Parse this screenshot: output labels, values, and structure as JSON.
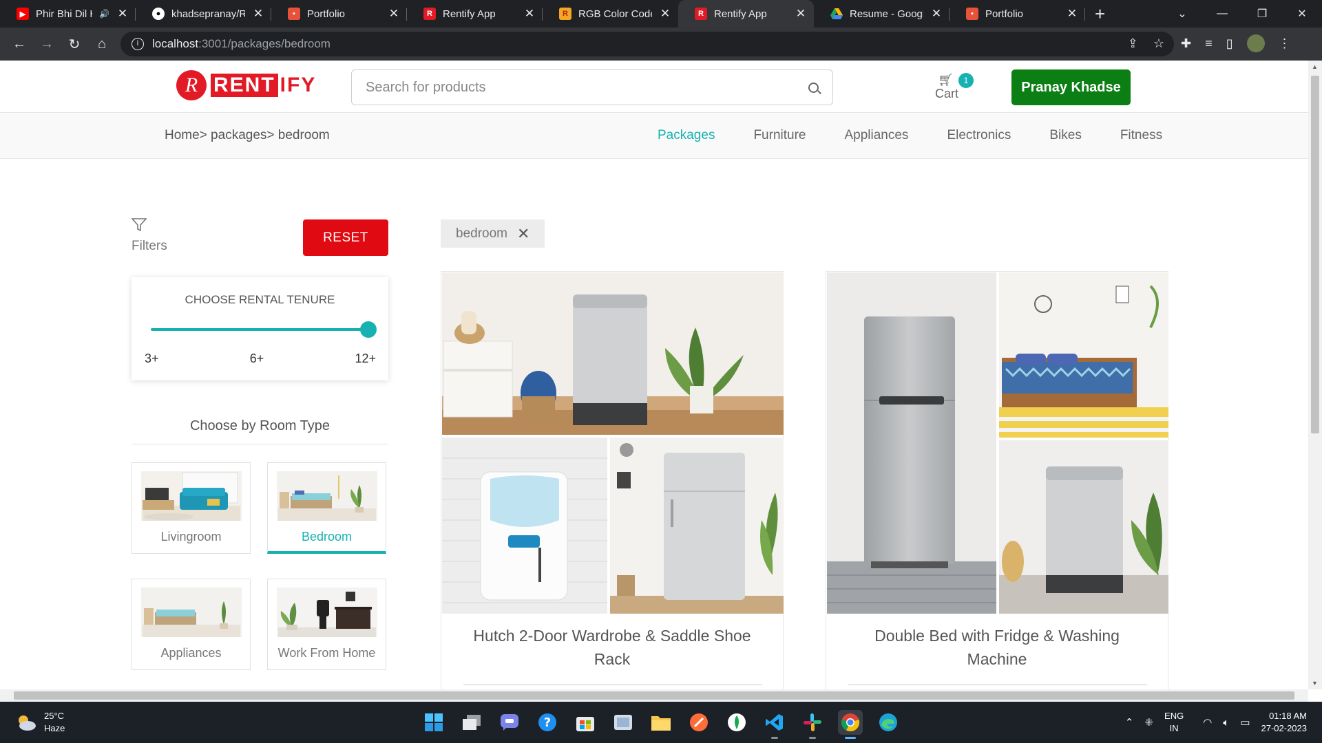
{
  "browser": {
    "tabs": [
      {
        "title": "Phir Bhi Dil Ha",
        "favicon": "youtube-icon",
        "color": "#ff0000",
        "audio": true,
        "active": false
      },
      {
        "title": "khadsepranay/Re",
        "favicon": "github-icon",
        "color": "#ffffff",
        "active": false
      },
      {
        "title": "Portfolio",
        "favicon": "portfolio-icon",
        "color": "#e8523a",
        "active": false
      },
      {
        "title": "Rentify App",
        "favicon": "rentify-icon",
        "color": "#e11a26",
        "active": false
      },
      {
        "title": "RGB Color Codes",
        "favicon": "rgb-icon",
        "color": "#f5a623",
        "active": false
      },
      {
        "title": "Rentify App",
        "favicon": "rentify-icon",
        "color": "#e11a26",
        "active": true
      },
      {
        "title": "Resume - Google",
        "favicon": "google-drive-icon",
        "color": "#1fa463",
        "active": false
      },
      {
        "title": "Portfolio",
        "favicon": "portfolio-icon",
        "color": "#e8523a",
        "active": false
      }
    ],
    "url_host": "localhost",
    "url_path": ":3001/packages/bedroom"
  },
  "header": {
    "logo_letter": "R",
    "logo_rent": "RENT",
    "logo_ify": "IFY",
    "search_placeholder": "Search for products",
    "cart_label": "Cart",
    "cart_count": "1",
    "user_name": "Pranay Khadse"
  },
  "subnav": {
    "breadcrumb": "Home> packages> bedroom",
    "categories": [
      "Packages",
      "Furniture",
      "Appliances",
      "Electronics",
      "Bikes",
      "Fitness"
    ],
    "active_category": "Packages"
  },
  "sidebar": {
    "filters_label": "Filters",
    "reset_label": "RESET",
    "tenure_title": "CHOOSE RENTAL TENURE",
    "tenure_ticks": [
      "3+",
      "6+",
      "12+"
    ],
    "tenure_selected": "12+",
    "room_title": "Choose by Room Type",
    "rooms": [
      {
        "label": "Livingroom",
        "active": false
      },
      {
        "label": "Bedroom",
        "active": true
      },
      {
        "label": "Appliances",
        "active": false
      },
      {
        "label": "Work From Home",
        "active": false
      }
    ]
  },
  "main": {
    "active_filter_chip": "bedroom",
    "products": [
      {
        "name": "Hutch 2-Door Wardrobe & Saddle Shoe Rack"
      },
      {
        "name": "Double Bed with Fridge & Washing Machine"
      }
    ]
  },
  "taskbar": {
    "temperature": "25°C",
    "condition": "Haze",
    "language": "ENG",
    "region": "IN",
    "time": "01:18 AM",
    "date": "27-02-2023"
  },
  "colors": {
    "accent": "#16b1b0",
    "brand": "#e11a26",
    "reset": "#e00b12",
    "user_button": "#0b7f14"
  }
}
